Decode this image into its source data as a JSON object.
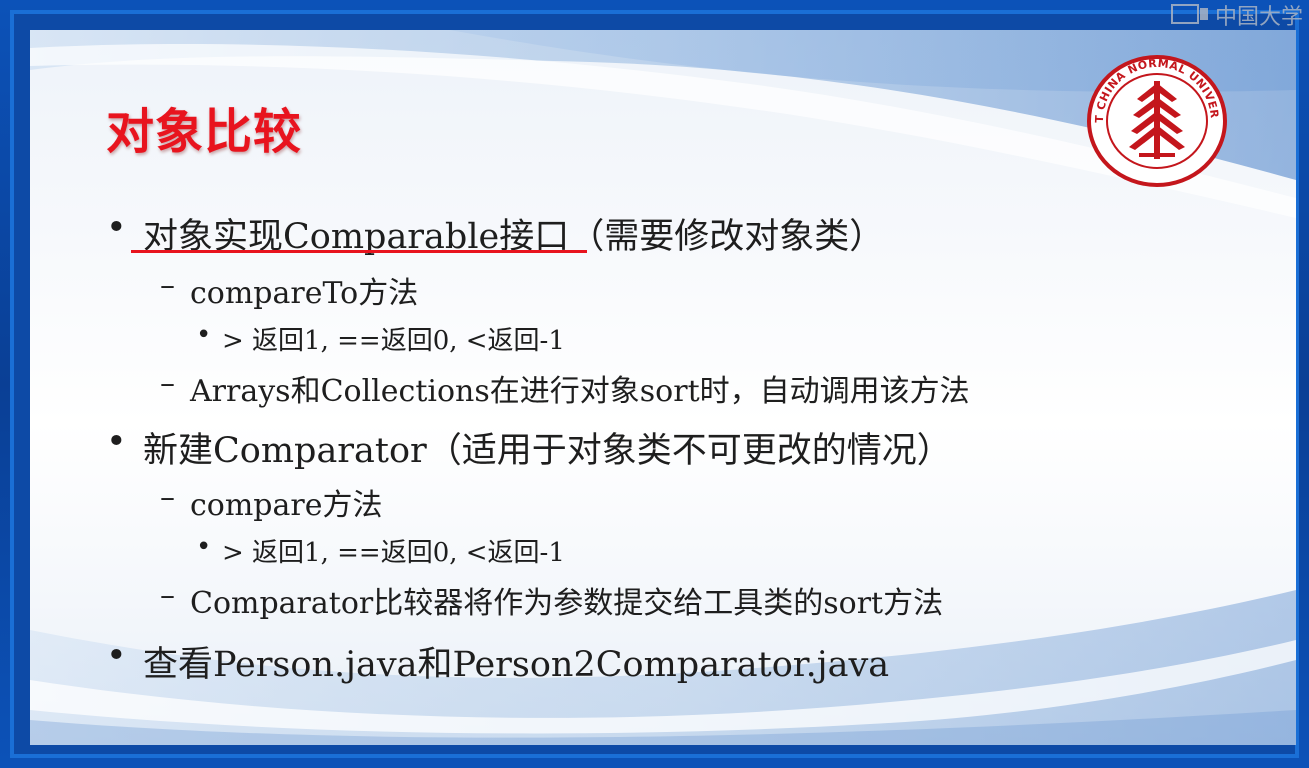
{
  "brand": {
    "label": "中国大学"
  },
  "slide": {
    "title": "对象比较",
    "logo": {
      "ring_text": "EAST CHINA NORMAL UNIVERSITY",
      "color": "#c4161c"
    },
    "accent_color": "#e8141e",
    "bullets": [
      {
        "text": "对象实现Comparable接口（需要修改对象类）",
        "children": [
          {
            "text": "compareTo方法",
            "children": [
              {
                "text": "> 返回1, ==返回0, <返回-1"
              }
            ]
          },
          {
            "text": "Arrays和Collections在进行对象sort时，自动调用该方法"
          }
        ]
      },
      {
        "text": "新建Comparator（适用于对象类不可更改的情况）",
        "children": [
          {
            "text": "compare方法",
            "children": [
              {
                "text": "> 返回1, ==返回0, <返回-1"
              }
            ]
          },
          {
            "text": "Comparator比较器将作为参数提交给工具类的sort方法"
          }
        ]
      },
      {
        "text": "查看Person.java和Person2Comparator.java"
      }
    ]
  }
}
